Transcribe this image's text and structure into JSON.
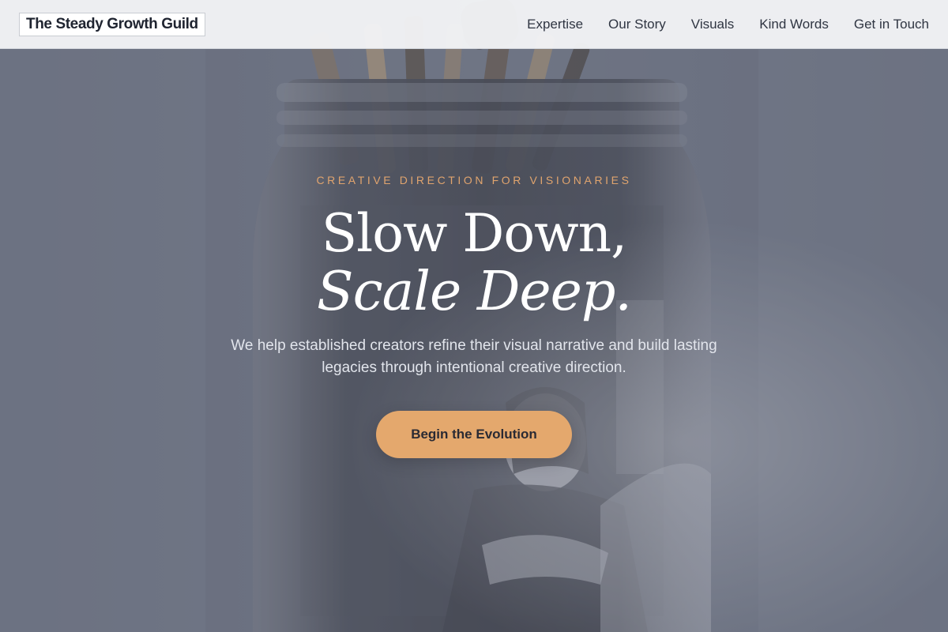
{
  "header": {
    "brand": "The Steady Growth Guild",
    "nav": [
      {
        "label": "Expertise"
      },
      {
        "label": "Our Story"
      },
      {
        "label": "Visuals"
      },
      {
        "label": "Kind Words"
      },
      {
        "label": "Get in Touch"
      }
    ]
  },
  "hero": {
    "eyebrow": "CREATIVE DIRECTION FOR VISIONARIES",
    "headline_line1": "Slow Down,",
    "headline_line2": "Scale Deep.",
    "lead": "We help established creators refine their visual narrative and build lasting legacies through intentional creative direction.",
    "cta_label": "Begin the Evolution",
    "background_image": "glass-jar-with-brushes-and-woman-reading"
  },
  "colors": {
    "accent": "#e4a86d",
    "eyebrow": "#e0a46e",
    "header_bg": "#f3f4f6",
    "hero_tint": "#6f7583",
    "text_dark": "#2f3542"
  }
}
